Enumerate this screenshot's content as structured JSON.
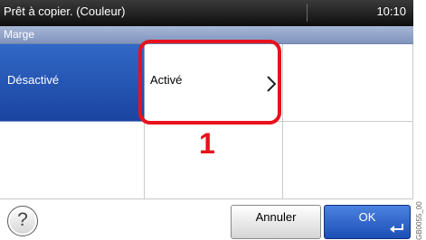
{
  "status": {
    "text": "Prêt à copier. (Couleur)",
    "clock": "10:10"
  },
  "title": "Marge",
  "options": [
    {
      "label": "Désactivé",
      "selected": true
    },
    {
      "label": "Activé",
      "selected": false
    }
  ],
  "annotation": {
    "number": "1",
    "color": "#e8111c"
  },
  "buttons": {
    "cancel": "Annuler",
    "ok": "OK",
    "help": "?"
  },
  "side_code": "GB0055_00",
  "colors": {
    "selected": "#1f4fb0",
    "title_bar": "#8fa1c8"
  },
  "icons": {
    "chevron": "chevron-right-icon",
    "enter": "enter-icon",
    "help": "question-mark-icon"
  }
}
